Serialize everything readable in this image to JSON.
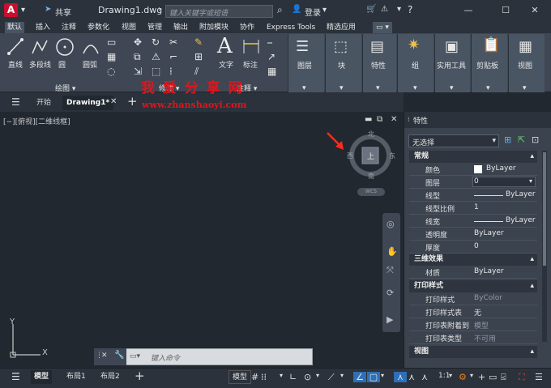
{
  "app": {
    "logo": "A",
    "share": "共享",
    "doc_title": "Drawing1.dwg",
    "search_placeholder": "键入关键字或短语",
    "login": "登录"
  },
  "ribbon_tabs": [
    "默认",
    "插入",
    "注释",
    "参数化",
    "视图",
    "管理",
    "输出",
    "附加模块",
    "协作",
    "Express Tools",
    "精选应用"
  ],
  "draw_tools": [
    "直线",
    "多段线",
    "圆",
    "圆弧"
  ],
  "draw_panel_label": "绘图 ▾",
  "modify_panel_label": "修改 ▾",
  "annot_tools": [
    "文字",
    "标注"
  ],
  "annot_panel_label": "注释 ▾",
  "big_panels": [
    "图层",
    "块",
    "特性",
    "组",
    "实用工具",
    "剪贴板",
    "视图"
  ],
  "doc_tabs": [
    "开始",
    "Drawing1*"
  ],
  "watermark": {
    "title": "我 爱 分 享 网",
    "url": "www.zhanshaoyi.com"
  },
  "viewport_label": "[−][俯视][二维线框]",
  "viewcube": {
    "n": "北",
    "s": "南",
    "e": "东",
    "w": "西",
    "top": "上",
    "wcs": "WCS"
  },
  "ucs": {
    "x": "X",
    "y": "Y"
  },
  "cmd_placeholder": "键入命令",
  "layout_tabs": [
    "模型",
    "布局1",
    "布局2"
  ],
  "status": {
    "model": "模型",
    "scale": "1:1"
  },
  "props": {
    "title": "特性",
    "selection": "无选择",
    "sections": {
      "general": "常规",
      "three_d": "三维效果",
      "plot": "打印样式",
      "view": "视图"
    },
    "general": [
      {
        "k": "颜色",
        "v": "ByLayer"
      },
      {
        "k": "图层",
        "v": "0"
      },
      {
        "k": "线型",
        "v": "ByLayer"
      },
      {
        "k": "线型比例",
        "v": "1"
      },
      {
        "k": "线宽",
        "v": "ByLayer"
      },
      {
        "k": "透明度",
        "v": "ByLayer"
      },
      {
        "k": "厚度",
        "v": "0"
      }
    ],
    "three_d": [
      {
        "k": "材质",
        "v": "ByLayer"
      }
    ],
    "plot": [
      {
        "k": "打印样式",
        "v": "ByColor"
      },
      {
        "k": "打印样式表",
        "v": "无"
      },
      {
        "k": "打印表附着到",
        "v": "模型"
      },
      {
        "k": "打印表类型",
        "v": "不可用"
      }
    ]
  }
}
